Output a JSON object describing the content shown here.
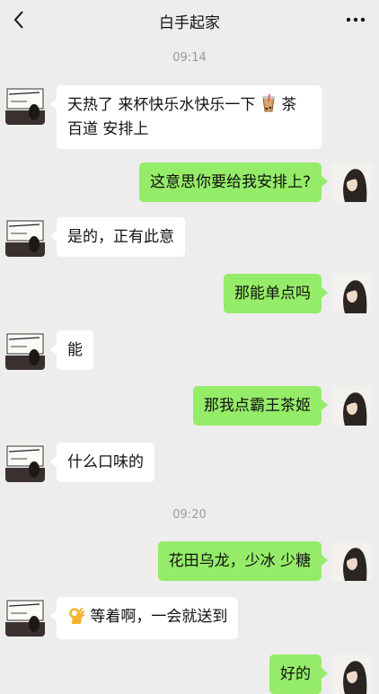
{
  "header": {
    "title": "白手起家",
    "back_icon": "chevron-left-icon",
    "more_icon": "more-icon"
  },
  "times": [
    "09:14",
    "09:20"
  ],
  "messages": [
    {
      "side": "in",
      "text_before": "天热了 来杯快乐水快乐一下",
      "emoji": "bubble-tea-icon",
      "text_after": "茶百道 安排上"
    },
    {
      "side": "out",
      "text": "这意思你要给我安排上?"
    },
    {
      "side": "in",
      "text": "是的，正有此意"
    },
    {
      "side": "out",
      "text": "那能单点吗"
    },
    {
      "side": "in",
      "text": "能"
    },
    {
      "side": "out",
      "text": "那我点霸王茶姬"
    },
    {
      "side": "in",
      "text": "什么口味的"
    },
    {
      "side": "out",
      "text": "花田乌龙，少冰 少糖"
    },
    {
      "side": "in",
      "emoji": "ok-hand-icon",
      "text": "等着啊，一会就送到"
    },
    {
      "side": "out",
      "text": "好的"
    }
  ],
  "colors": {
    "background": "#ededed",
    "incoming_bubble": "#ffffff",
    "outgoing_bubble": "#95ec69"
  }
}
